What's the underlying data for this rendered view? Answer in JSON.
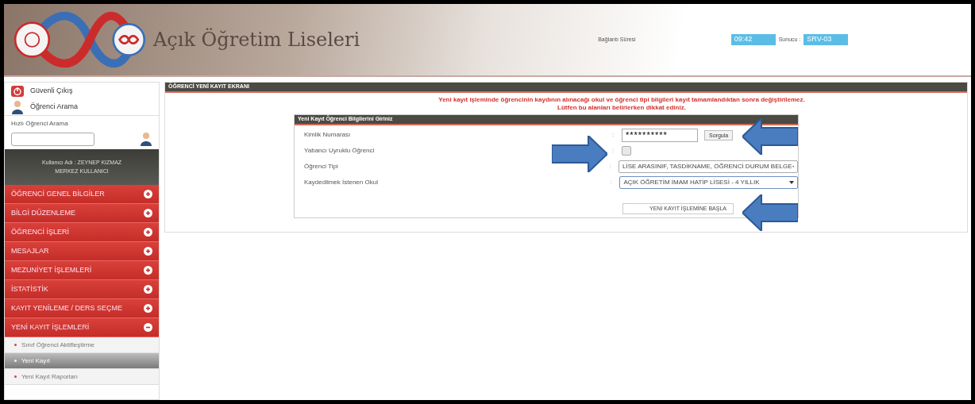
{
  "header": {
    "title": "Açık Öğretim Liseleri",
    "session_label": "Bağlantı Süresi",
    "session_value": "09:42",
    "server_label": "Sunucu :",
    "server_value": "SRV-03"
  },
  "sidebar": {
    "logout": "Güvenli Çıkış",
    "student_search": "Öğrenci Arama",
    "quick_search_label": "Hızlı Öğrenci Arama",
    "user_lines": [
      "Kullanıcı Adı : ZEYNEP KIZMAZ",
      "MERKEZ KULLANICI"
    ],
    "menu": [
      {
        "label": "ÖĞRENCİ GENEL BİLGİLER",
        "expanded": false
      },
      {
        "label": "BİLGİ DÜZENLEME",
        "expanded": false
      },
      {
        "label": "ÖĞRENCİ İŞLERİ",
        "expanded": false
      },
      {
        "label": "MESAJLAR",
        "expanded": false
      },
      {
        "label": "MEZUNİYET İŞLEMLERİ",
        "expanded": false
      },
      {
        "label": "İSTATİSTİK",
        "expanded": false
      },
      {
        "label": "KAYIT YENİLEME / DERS SEÇME",
        "expanded": false
      },
      {
        "label": "YENİ KAYIT İŞLEMLERİ",
        "expanded": true,
        "children": [
          {
            "label": "Sınıf Öğrenci Aktifleştirme",
            "selected": false
          },
          {
            "label": "Yeni Kayıt",
            "selected": true
          },
          {
            "label": "Yeni Kayıt Raporları",
            "selected": false
          }
        ]
      }
    ]
  },
  "main": {
    "title": "ÖĞRENCİ YENİ KAYIT EKRANI",
    "warning": [
      "Yeni kayıt işleminde öğrencinin kaydının alınacağı okul ve öğrenci tipi bilgileri kayıt tamamlandıktan sonra değiştirilemez.",
      "Lütfen bu alanları belirlerken dikkat ediniz."
    ],
    "form": {
      "title": "Yeni Kayıt Öğrenci Bilgilerini Giriniz",
      "fields": [
        {
          "kind": "text",
          "label": "Kimlik Numarası",
          "separator": ":",
          "value": "**********",
          "button": "Sorgula"
        },
        {
          "kind": "checkbox",
          "label": "Yabancı Uyruklu Öğrenci",
          "separator": ":",
          "checked": false
        },
        {
          "kind": "select",
          "label": "Öğrenci Tipi",
          "separator": ":",
          "value": "LİSE ARASINIF, TASDİKNAME, ÖĞRENCİ DURUM BELGE"
        },
        {
          "kind": "select",
          "label": "Kaydedilmek İstenen Okul",
          "separator": ":",
          "value": "AÇIK ÖĞRETİM İMAM HATİP LİSESİ - 4 YILLIK"
        }
      ],
      "submit": "YENİ KAYIT İŞLEMİNE BAŞLA"
    }
  }
}
